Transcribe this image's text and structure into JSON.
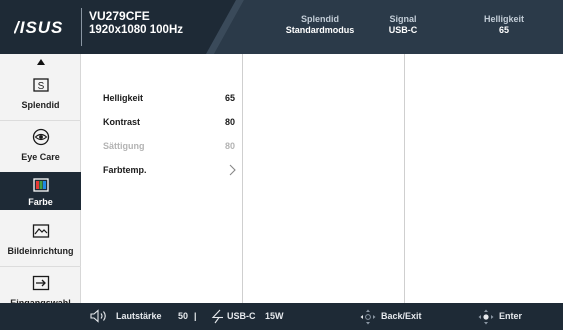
{
  "header": {
    "logo_text": "ASUS",
    "model": "VU279CFE",
    "resolution": "1920x1080 100Hz",
    "stats": [
      {
        "label": "Splendid",
        "value": "Standardmodus"
      },
      {
        "label": "Signal",
        "value": "USB-C"
      },
      {
        "label": "Helligkeit",
        "value": "65"
      }
    ]
  },
  "sidebar": {
    "up_icon": "triangle-up-icon",
    "down_icon": "triangle-down-icon",
    "items": [
      {
        "label": "Splendid",
        "icon": "splendid-icon",
        "active": false
      },
      {
        "label": "Eye Care",
        "icon": "eye-care-icon",
        "active": false
      },
      {
        "label": "Farbe",
        "icon": "color-icon",
        "active": true
      },
      {
        "label": "Bildeinrichtung",
        "icon": "image-setup-icon",
        "active": false
      },
      {
        "label": "Eingangswahl",
        "icon": "input-select-icon",
        "active": false
      }
    ]
  },
  "menu": {
    "rows": [
      {
        "name": "Helligkeit",
        "value": "65",
        "disabled": false
      },
      {
        "name": "Kontrast",
        "value": "80",
        "disabled": false
      },
      {
        "name": "Sättigung",
        "value": "80",
        "disabled": true
      },
      {
        "name": "Farbtemp.",
        "value": "",
        "disabled": false,
        "icon": "chevron-right-icon"
      }
    ]
  },
  "footer": {
    "volume_label": "Lautstärke",
    "volume_value": "50",
    "separator": "|",
    "usb_label": "USB-C",
    "usb_value": "15W",
    "back_label": "Back/Exit",
    "enter_label": "Enter"
  },
  "colors": {
    "dark": "#1e2a36",
    "sidebar_bg": "#f3f3f3"
  }
}
